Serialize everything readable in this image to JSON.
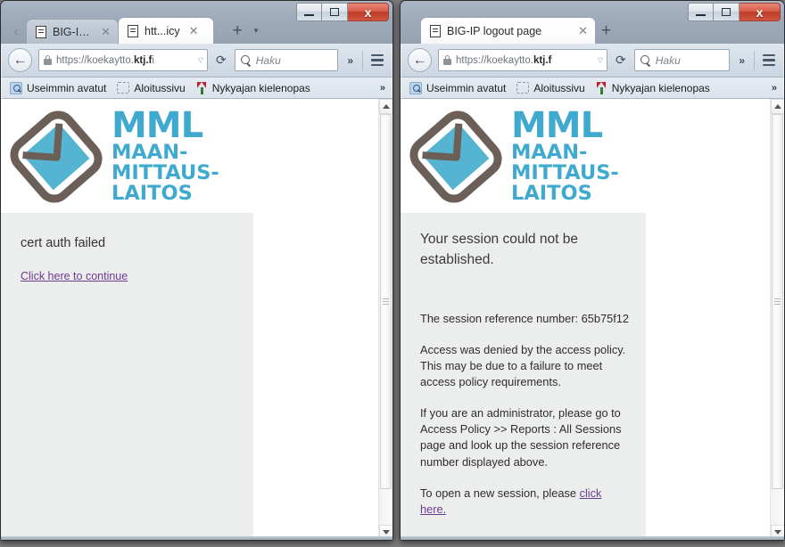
{
  "desktop": {
    "background_color": "#7a7a7a"
  },
  "windows": [
    {
      "id": "left",
      "title_bar": {
        "minimize_label": "Minimize",
        "maximize_label": "Maximize",
        "close_label": "x"
      },
      "tabs": {
        "scroll_left_label": "‹",
        "scroll_right_label": "›",
        "new_tab_label": "+",
        "list_all_tabs_label": "▾",
        "items": [
          {
            "title": "BIG-IP...",
            "active": false,
            "close_label": "✕"
          },
          {
            "title": "htt...icy",
            "active": true,
            "close_label": "✕"
          }
        ]
      },
      "navbar": {
        "back_label": "←",
        "url_prefix": "https://koekaytto.",
        "url_domain": "ktj.f",
        "url_suffix": "i",
        "url_caret": "▽",
        "reload_label": "⟳",
        "search_placeholder": "Haku",
        "overflow_label": "»",
        "menu_label": "Menu"
      },
      "bookmarks": {
        "items": [
          {
            "label": "Useimmin avatut",
            "icon": "history-icon"
          },
          {
            "label": "Aloitussivu",
            "icon": "dashed-box-icon"
          },
          {
            "label": "Nykyajan kielenopas",
            "icon": "y-bookmark-icon"
          }
        ],
        "overflow_label": "»"
      },
      "page": {
        "logo_alt": "MML Maanmittauslaitos",
        "logo_line1": "MML",
        "logo_line2": "MAAN-",
        "logo_line3": "MITTAUS-",
        "logo_line4": "LAITOS",
        "heading": "cert auth failed",
        "link_text": "Click here to continue"
      },
      "scrollbar": {
        "up_label": "▲",
        "down_label": "▼"
      }
    },
    {
      "id": "right",
      "title_bar": {
        "minimize_label": "Minimize",
        "maximize_label": "Maximize",
        "close_label": "x"
      },
      "tabs": {
        "new_tab_label": "+",
        "items": [
          {
            "title": "BIG-IP logout page",
            "active": true,
            "close_label": "✕"
          }
        ]
      },
      "navbar": {
        "back_label": "←",
        "url_prefix": "https://koekaytto.",
        "url_domain": "ktj.f",
        "url_suffix": "",
        "url_caret": "▽",
        "reload_label": "⟳",
        "search_placeholder": "Haku",
        "overflow_label": "»",
        "menu_label": "Menu"
      },
      "bookmarks": {
        "items": [
          {
            "label": "Useimmin avatut",
            "icon": "history-icon"
          },
          {
            "label": "Aloitussivu",
            "icon": "dashed-box-icon"
          },
          {
            "label": "Nykyajan kielenopas",
            "icon": "y-bookmark-icon"
          }
        ],
        "overflow_label": "»"
      },
      "page": {
        "logo_alt": "MML Maanmittauslaitos",
        "logo_line1": "MML",
        "logo_line2": "MAAN-",
        "logo_line3": "MITTAUS-",
        "logo_line4": "LAITOS",
        "heading": "Your session could not be established.",
        "session_ref_label": "The session reference number:  65b75f12",
        "paragraph_denied": "Access was denied by the access policy. This may be due to a failure to meet access policy requirements.",
        "paragraph_admin": "If you are an administrator, please go to Access Policy >> Reports : All Sessions page and look up the session reference number displayed above.",
        "paragraph_newsession_prefix": "To open a new session, please ",
        "paragraph_newsession_link": "click here."
      },
      "scrollbar": {
        "up_label": "▲",
        "down_label": "▼"
      }
    }
  ],
  "colors": {
    "logo_blue": "#56b4d3",
    "logo_frame": "#6b5f58",
    "page_panel": "#eceded",
    "visited_link": "#6b3b8f",
    "close_button_red": "#bc3a27"
  }
}
